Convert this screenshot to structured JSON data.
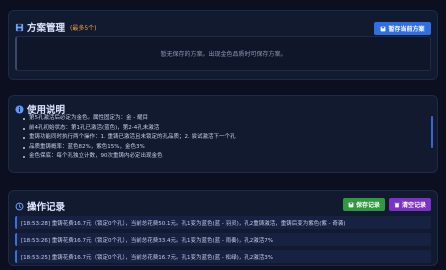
{
  "scheme": {
    "title": "方案管理",
    "limit_note": "(最多5个)",
    "save_button": "暂存当前方案",
    "empty_text": "暂无保存的方案。出现金色品质时可保存方案。"
  },
  "instructions": {
    "title": "使用说明",
    "items": [
      "第5孔激活后必定为金色。属性固定为：金 - 耀目",
      "前4孔初始状态：第1孔已激活(蓝色)，第2-4孔未激活",
      "重铸功能同时执行两个操作：1. 重铸已激活且未锁定的孔品质；2. 尝试激活下一个孔",
      "品质重铸概率：蓝色82%，紫色15%，金色3%",
      "金色保底：每个孔独立计数，90次重铸内必定出现金色"
    ]
  },
  "log": {
    "title": "操作记录",
    "save_button": "保存记录",
    "clear_button": "清空记录",
    "entries": [
      "[18:53:28] 重铸花费16.7元（锁定0个孔），当前总花费50.1元。孔1变为蓝色(蓝 - 羽灵)，孔2重铸激活，重铸后变为紫色(紫 - 奇袭)",
      "[18:53:26] 重铸花费16.7元（锁定0个孔），当前总花费33.4元。孔1变为蓝色(蓝 - 雨奏)，孔2激活7%",
      "[18:53:25] 重铸花费16.7元（锁定0个孔），当前总花费16.7元。孔1变为蓝色(蓝 - 松绿)，孔2激活3%"
    ]
  },
  "colors": {
    "bg": "#0b0f1f",
    "panel": "#121a30",
    "accent_blue": "#2f6fe4",
    "save_green": "#2e9a3d",
    "clear_purple": "#7b32c9",
    "gold_note": "#f0a73a"
  }
}
